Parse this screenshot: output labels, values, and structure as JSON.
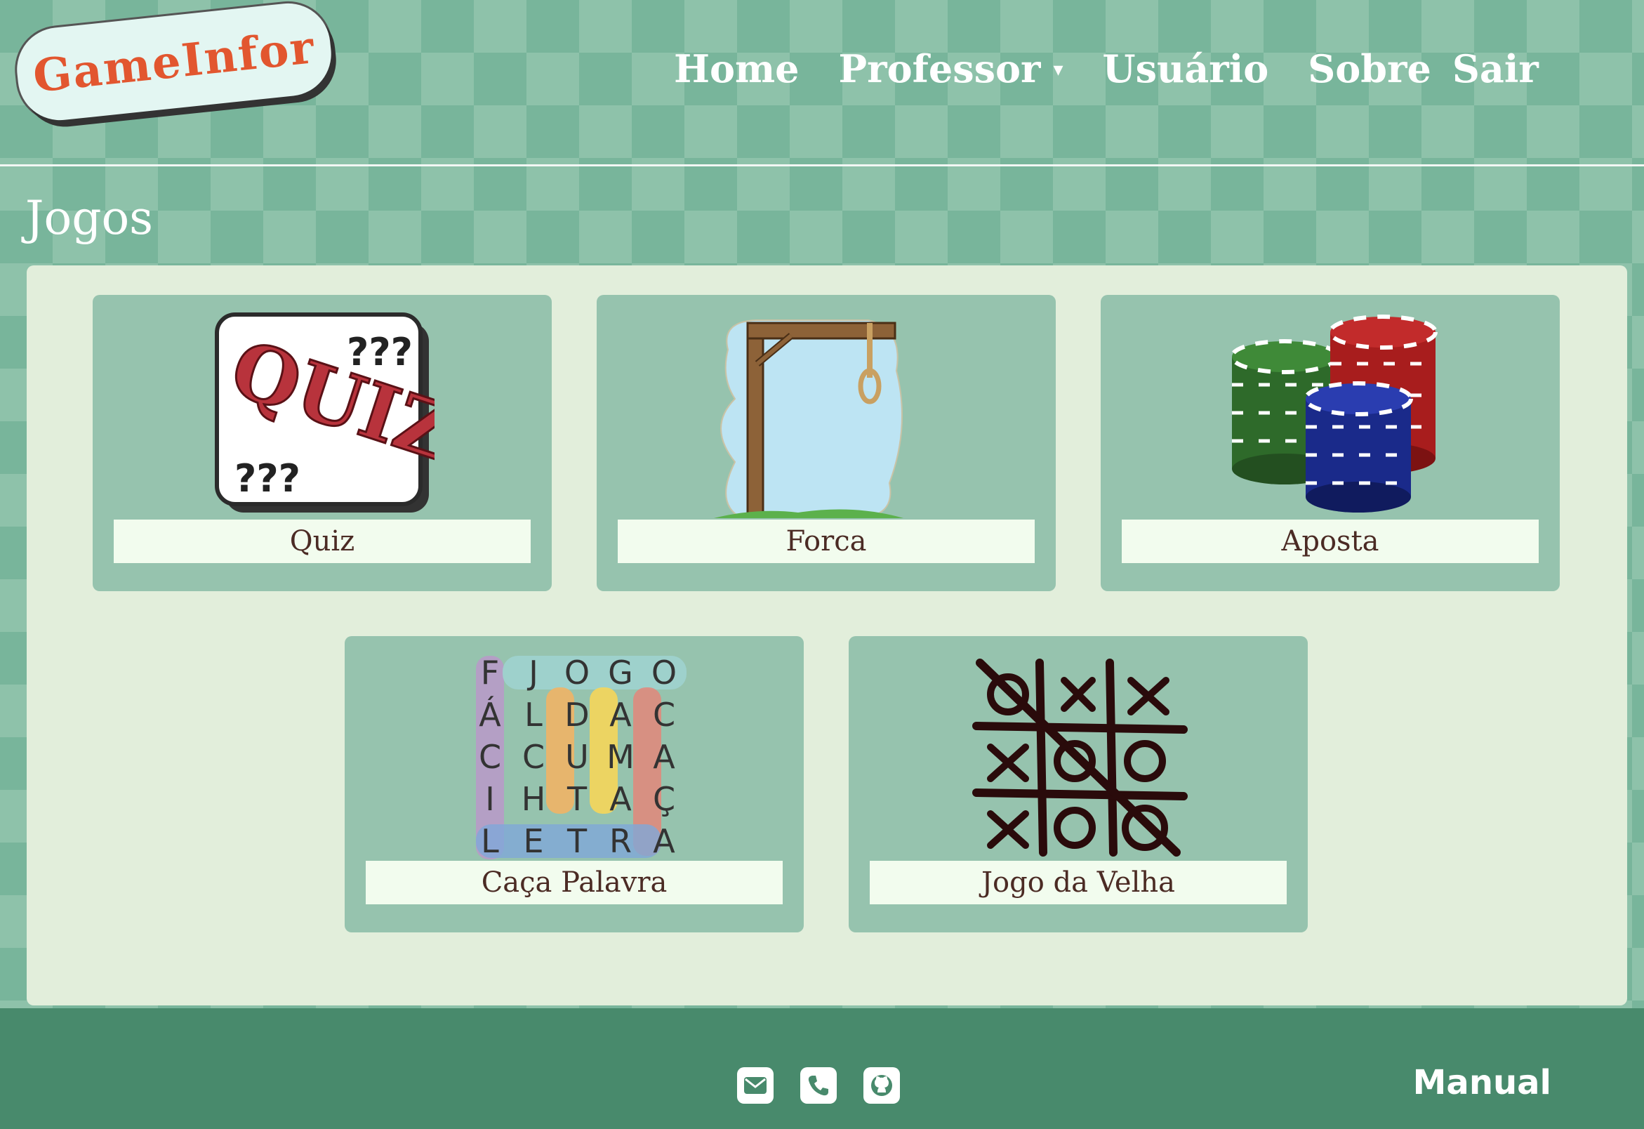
{
  "brand": {
    "logo_text": "GameInfor"
  },
  "nav": {
    "home": "Home",
    "professor": "Professor",
    "usuario": "Usuário",
    "sobre": "Sobre",
    "sair": "Sair"
  },
  "page": {
    "title": "Jogos"
  },
  "games": [
    {
      "label": "Quiz",
      "icon": "quiz-icon"
    },
    {
      "label": "Forca",
      "icon": "gallows-icon"
    },
    {
      "label": "Aposta",
      "icon": "poker-chips-icon"
    },
    {
      "label": "Caça Palavra",
      "icon": "word-search-icon"
    },
    {
      "label": "Jogo da Velha",
      "icon": "tic-tac-toe-icon"
    }
  ],
  "quiz_thumb": {
    "word": "QUIZ",
    "marks": "???"
  },
  "word_search": {
    "rows": [
      [
        "F",
        "J",
        "O",
        "G",
        "O"
      ],
      [
        "Á",
        "L",
        "D",
        "A",
        "C"
      ],
      [
        "C",
        "C",
        "U",
        "M",
        "A"
      ],
      [
        "I",
        "H",
        "T",
        "A",
        "Ç"
      ],
      [
        "L",
        "E",
        "T",
        "R",
        "A"
      ]
    ]
  },
  "footer": {
    "icons": [
      "email-icon",
      "phone-icon",
      "github-icon"
    ],
    "manual": "Manual"
  },
  "colors": {
    "background": "#78b59b",
    "panel": "#e2eedb",
    "card": "#96c3ae",
    "label_bg": "#f2fcee",
    "footer": "#488a6c",
    "logo_text": "#e2562f"
  }
}
